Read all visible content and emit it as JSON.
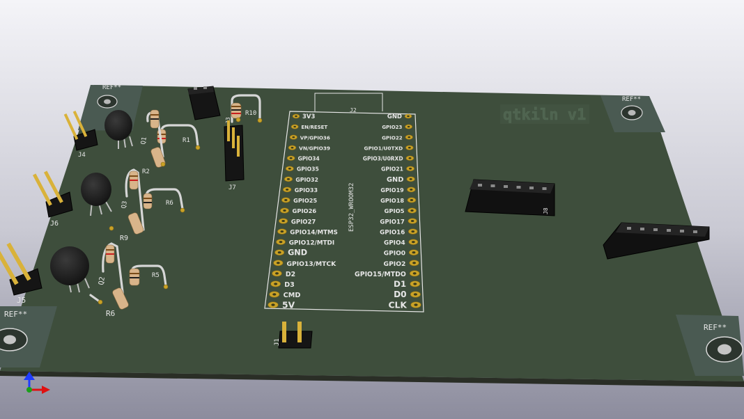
{
  "board": {
    "title": "qtkiln v1",
    "mounting_label": "REF**",
    "colors": {
      "background_top": "#f2f2f7",
      "background_bottom": "#8f8fa0",
      "board": "#3e4e3c",
      "board_edge": "#2a2e26",
      "pad_area": "#4a5a52",
      "silkscreen": "#e6e6e6",
      "gold": "#c9a227"
    }
  },
  "components": {
    "resistors": [
      "R1",
      "R2",
      "R6",
      "R9",
      "R10",
      "R5",
      "R6"
    ],
    "transistors": [
      "Q1",
      "Q2",
      "Q3"
    ],
    "connectors": [
      "J1",
      "J2",
      "J3",
      "J4",
      "J5",
      "J6",
      "J7",
      "J8"
    ]
  },
  "module": {
    "ref": "J2",
    "name": "ESP32_WROOM32",
    "left_pins": [
      "3V3",
      "EN/RESET",
      "VP/GPIO36",
      "VN/GPIO39",
      "GPIO34",
      "GPIO35",
      "GPIO32",
      "GPIO33",
      "GPIO25",
      "GPIO26",
      "GPIO27",
      "GPIO14/MTMS",
      "GPIO12/MTDI",
      "GND",
      "GPIO13/MTCK",
      "D2",
      "D3",
      "CMD",
      "5V"
    ],
    "right_pins": [
      "GND",
      "GPIO23",
      "GPIO22",
      "GPIO1/U0TXD",
      "GPIO3/U0RXD",
      "GPIO21",
      "GND",
      "GPIO19",
      "GPIO18",
      "GPIO5",
      "GPIO17",
      "GPIO16",
      "GPIO4",
      "GPIO0",
      "GPIO2",
      "GPIO15/MTDO",
      "D1",
      "D0",
      "CLK"
    ]
  },
  "axes_gizmo": {
    "up": "z-axis",
    "right": "x-axis",
    "up_color": "#1e3cff",
    "right_color": "#e01010"
  }
}
